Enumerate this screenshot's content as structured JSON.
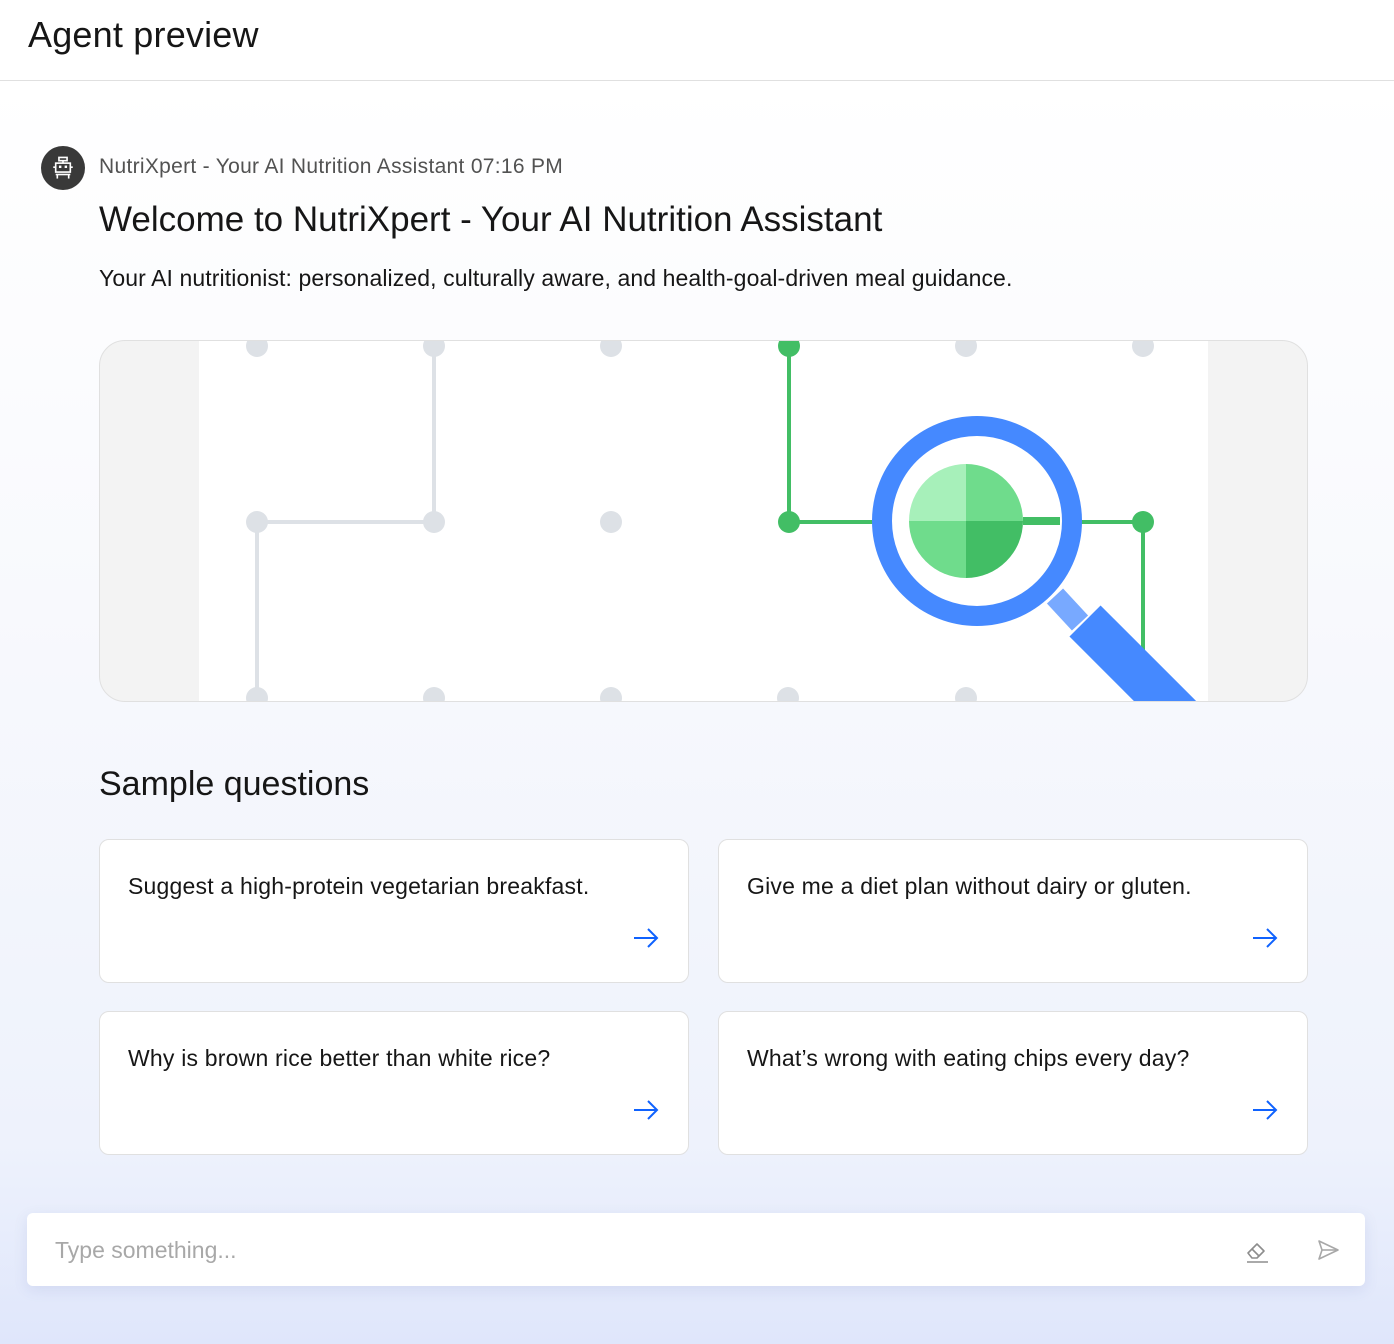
{
  "header": {
    "title": "Agent preview"
  },
  "message": {
    "avatar_icon": "robot-icon",
    "sender": "NutriXpert - Your AI Nutrition Assistant",
    "time": "07:16 PM",
    "title": "Welcome to NutriXpert - Your AI Nutrition Assistant",
    "description": "Your AI nutritionist: personalized, culturally aware, and health-goal-driven meal guidance."
  },
  "sample": {
    "heading": "Sample questions",
    "questions": [
      {
        "text": "Suggest a high-protein vegetarian breakfast.",
        "icon": "arrow-right-icon"
      },
      {
        "text": "Give me a diet plan without dairy or gluten.",
        "icon": "arrow-right-icon"
      },
      {
        "text": "Why is brown rice better than white rice?",
        "icon": "arrow-right-icon"
      },
      {
        "text": "What’s wrong with eating chips every day?",
        "icon": "arrow-right-icon"
      }
    ]
  },
  "input": {
    "placeholder": "Type something...",
    "value": "",
    "clear_icon": "eraser-icon",
    "send_icon": "send-icon"
  },
  "colors": {
    "accent_blue": "#4589ff",
    "link_blue": "#0f62fe",
    "green": "#42be65",
    "light_green": "#6fdc8c",
    "pale_green": "#a7f0ba",
    "grid_gray": "#dde1e6"
  }
}
